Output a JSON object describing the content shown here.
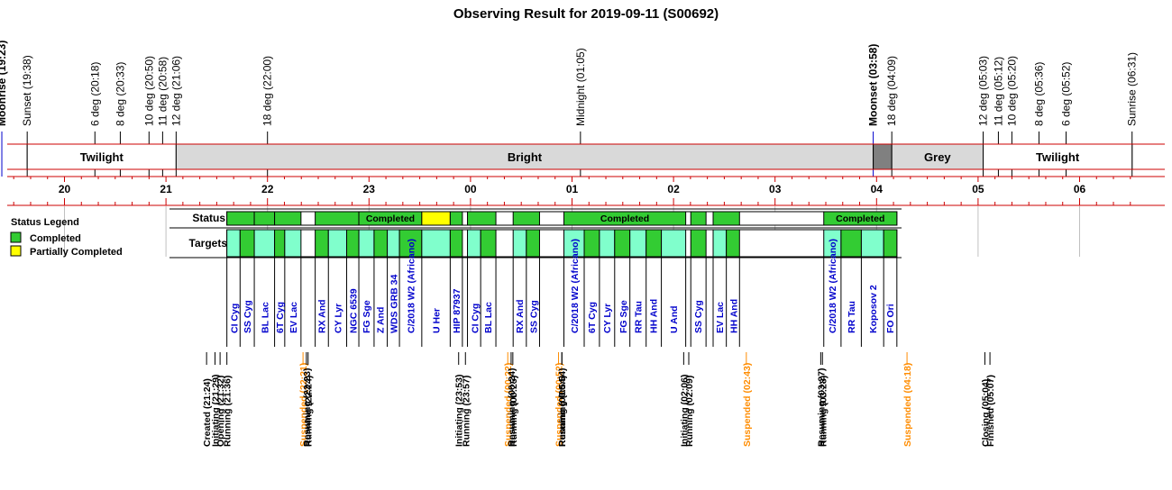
{
  "chart_data": {
    "type": "timeline",
    "title": "Observing Result for 2019-09-11 (S00692)",
    "time_axis": {
      "start_hour": 19.383,
      "end_hour": 30.533,
      "tick_labels": [
        "20",
        "21",
        "22",
        "23",
        "00",
        "01",
        "02",
        "03",
        "04",
        "05",
        "06"
      ]
    },
    "colors": {
      "completed": "#33cc33",
      "partially_completed": "#ffff00",
      "target_alt": "#80ffcc",
      "twilight_band": "#ffffff",
      "bright_band": "#d9d9d9",
      "dark_band": "#808080",
      "grey_band": "#d9d9d9",
      "axis_red": "#cc0000",
      "moon_blue": "#0000cc",
      "suspended_orange": "#ff8c00"
    },
    "sky_events": [
      {
        "label": "Moonrise (19:23)",
        "t": 19.383,
        "moon": true
      },
      {
        "label": "Sunset (19:38)",
        "t": 19.633,
        "moon": false
      },
      {
        "label": "6 deg (20:18)",
        "t": 20.3,
        "moon": false
      },
      {
        "label": "8 deg (20:33)",
        "t": 20.55,
        "moon": false
      },
      {
        "label": "10 deg (20:50)",
        "t": 20.833,
        "moon": false
      },
      {
        "label": "11 deg (20:58)",
        "t": 20.967,
        "moon": false
      },
      {
        "label": "12 deg (21:06)",
        "t": 21.1,
        "moon": false
      },
      {
        "label": "18 deg (22:00)",
        "t": 22.0,
        "moon": false
      },
      {
        "label": "Midnight (01:05)",
        "t": 25.083,
        "moon": false
      },
      {
        "label": "Moonset (03:58)",
        "t": 27.967,
        "moon": true
      },
      {
        "label": "18 deg (04:09)",
        "t": 28.15,
        "moon": false
      },
      {
        "label": "12 deg (05:03)",
        "t": 29.05,
        "moon": false
      },
      {
        "label": "11 deg (05:12)",
        "t": 29.2,
        "moon": false
      },
      {
        "label": "10 deg (05:20)",
        "t": 29.333,
        "moon": false
      },
      {
        "label": "8 deg (05:36)",
        "t": 29.6,
        "moon": false
      },
      {
        "label": "6 deg (05:52)",
        "t": 29.867,
        "moon": false
      },
      {
        "label": "Sunrise (06:31)",
        "t": 30.517,
        "moon": false
      }
    ],
    "sky_bands": [
      {
        "label": "Twilight",
        "t0": 19.633,
        "t1": 21.1,
        "kind": "twilight"
      },
      {
        "label": "Bright",
        "t0": 21.1,
        "t1": 27.967,
        "kind": "bright"
      },
      {
        "label": "",
        "t0": 27.967,
        "t1": 28.15,
        "kind": "dark"
      },
      {
        "label": "Grey",
        "t0": 28.15,
        "t1": 29.05,
        "kind": "grey"
      },
      {
        "label": "Twilight",
        "t0": 29.05,
        "t1": 30.517,
        "kind": "twilight"
      }
    ],
    "row_labels": {
      "status": "Status",
      "targets": "Targets"
    },
    "status_segments": [
      {
        "t0": 21.6,
        "t1": 21.87,
        "state": "completed",
        "label": ""
      },
      {
        "t0": 21.87,
        "t1": 22.07,
        "state": "completed",
        "label": ""
      },
      {
        "t0": 22.07,
        "t1": 22.33,
        "state": "completed",
        "label": ""
      },
      {
        "t0": 22.47,
        "t1": 22.9,
        "state": "completed",
        "label": ""
      },
      {
        "t0": 22.9,
        "t1": 23.52,
        "state": "completed",
        "label": "Completed"
      },
      {
        "t0": 23.52,
        "t1": 23.8,
        "state": "partial",
        "label": ""
      },
      {
        "t0": 23.8,
        "t1": 23.92,
        "state": "completed",
        "label": ""
      },
      {
        "t0": 23.97,
        "t1": 24.25,
        "state": "completed",
        "label": ""
      },
      {
        "t0": 24.42,
        "t1": 24.68,
        "state": "completed",
        "label": ""
      },
      {
        "t0": 24.92,
        "t1": 26.12,
        "state": "completed",
        "label": "Completed"
      },
      {
        "t0": 26.17,
        "t1": 26.32,
        "state": "completed",
        "label": ""
      },
      {
        "t0": 26.39,
        "t1": 26.65,
        "state": "completed",
        "label": ""
      },
      {
        "t0": 27.48,
        "t1": 28.2,
        "state": "completed",
        "label": "Completed"
      }
    ],
    "target_segments": [
      {
        "t0": 21.6,
        "t1": 21.73,
        "state": "alt"
      },
      {
        "t0": 21.73,
        "t1": 21.87,
        "state": "completed"
      },
      {
        "t0": 21.87,
        "t1": 22.07,
        "state": "alt"
      },
      {
        "t0": 22.07,
        "t1": 22.17,
        "state": "completed"
      },
      {
        "t0": 22.17,
        "t1": 22.33,
        "state": "alt"
      },
      {
        "t0": 22.47,
        "t1": 22.6,
        "state": "completed"
      },
      {
        "t0": 22.6,
        "t1": 22.78,
        "state": "alt"
      },
      {
        "t0": 22.78,
        "t1": 22.9,
        "state": "completed"
      },
      {
        "t0": 22.9,
        "t1": 23.05,
        "state": "alt"
      },
      {
        "t0": 23.05,
        "t1": 23.18,
        "state": "completed"
      },
      {
        "t0": 23.18,
        "t1": 23.3,
        "state": "alt"
      },
      {
        "t0": 23.3,
        "t1": 23.52,
        "state": "completed"
      },
      {
        "t0": 23.52,
        "t1": 23.8,
        "state": "alt"
      },
      {
        "t0": 23.8,
        "t1": 23.92,
        "state": "completed"
      },
      {
        "t0": 23.97,
        "t1": 24.1,
        "state": "alt"
      },
      {
        "t0": 24.1,
        "t1": 24.25,
        "state": "completed"
      },
      {
        "t0": 24.42,
        "t1": 24.55,
        "state": "alt"
      },
      {
        "t0": 24.55,
        "t1": 24.68,
        "state": "completed"
      },
      {
        "t0": 24.92,
        "t1": 25.12,
        "state": "alt"
      },
      {
        "t0": 25.12,
        "t1": 25.27,
        "state": "completed"
      },
      {
        "t0": 25.27,
        "t1": 25.42,
        "state": "alt"
      },
      {
        "t0": 25.42,
        "t1": 25.57,
        "state": "completed"
      },
      {
        "t0": 25.57,
        "t1": 25.73,
        "state": "alt"
      },
      {
        "t0": 25.73,
        "t1": 25.88,
        "state": "completed"
      },
      {
        "t0": 25.88,
        "t1": 26.12,
        "state": "alt"
      },
      {
        "t0": 26.17,
        "t1": 26.32,
        "state": "completed"
      },
      {
        "t0": 26.39,
        "t1": 26.52,
        "state": "alt"
      },
      {
        "t0": 26.52,
        "t1": 26.65,
        "state": "completed"
      },
      {
        "t0": 27.48,
        "t1": 27.65,
        "state": "alt"
      },
      {
        "t0": 27.65,
        "t1": 27.85,
        "state": "completed"
      },
      {
        "t0": 27.85,
        "t1": 28.07,
        "state": "alt"
      },
      {
        "t0": 28.07,
        "t1": 28.2,
        "state": "completed"
      }
    ],
    "target_labels": [
      {
        "name": "CI Cyg",
        "t": 21.67
      },
      {
        "name": "SS Cyg",
        "t": 21.8
      },
      {
        "name": "BL Lac",
        "t": 21.97
      },
      {
        "name": "6T Cyg",
        "t": 22.12
      },
      {
        "name": "EV Lac",
        "t": 22.25
      },
      {
        "name": "RX And",
        "t": 22.53
      },
      {
        "name": "CY Lyr",
        "t": 22.69
      },
      {
        "name": "NGC 6539",
        "t": 22.84
      },
      {
        "name": "FG Sge",
        "t": 22.97
      },
      {
        "name": "Z And",
        "t": 23.11
      },
      {
        "name": "WDS GRB 34",
        "t": 23.24
      },
      {
        "name": "C/2018 W2 (Africano)",
        "t": 23.41
      },
      {
        "name": "U Her",
        "t": 23.66
      },
      {
        "name": "HIP 87937",
        "t": 23.86
      },
      {
        "name": "CI Cyg",
        "t": 24.04
      },
      {
        "name": "BL Lac",
        "t": 24.17
      },
      {
        "name": "RX And",
        "t": 24.48
      },
      {
        "name": "SS Cyg",
        "t": 24.62
      },
      {
        "name": "C/2018 W2 (Africano)",
        "t": 25.02
      },
      {
        "name": "6T Cyg",
        "t": 25.19
      },
      {
        "name": "CY Lyr",
        "t": 25.34
      },
      {
        "name": "FG Sge",
        "t": 25.5
      },
      {
        "name": "RR Tau",
        "t": 25.65
      },
      {
        "name": "HH And",
        "t": 25.8
      },
      {
        "name": "U And",
        "t": 26.0
      },
      {
        "name": "SS Cyg",
        "t": 26.24
      },
      {
        "name": "EV Lac",
        "t": 26.45
      },
      {
        "name": "HH And",
        "t": 26.59
      },
      {
        "name": "C/2018 W2 (Africano)",
        "t": 27.56
      },
      {
        "name": "RR Tau",
        "t": 27.75
      },
      {
        "name": "Koposov 2",
        "t": 27.96
      },
      {
        "name": "FO Ori",
        "t": 28.13
      }
    ],
    "log_events": [
      {
        "label": "Created (21:24)",
        "t": 21.4,
        "suspended": false
      },
      {
        "label": "Initiating (21:29)",
        "t": 21.483,
        "suspended": false
      },
      {
        "label": "Opening (21:32)",
        "t": 21.533,
        "suspended": false
      },
      {
        "label": "Running (21:36)",
        "t": 21.6,
        "suspended": false
      },
      {
        "label": "Suspended (22:21)",
        "t": 22.35,
        "suspended": true
      },
      {
        "label": "Resuming (22:23)",
        "t": 22.383,
        "suspended": false
      },
      {
        "label": "Running (22:24)",
        "t": 22.4,
        "suspended": false
      },
      {
        "label": "Initiating (23:53)",
        "t": 23.883,
        "suspended": false
      },
      {
        "label": "Running (23:57)",
        "t": 23.95,
        "suspended": false
      },
      {
        "label": "Suspended (00:22)",
        "t": 24.367,
        "suspended": true
      },
      {
        "label": "Resuming (00:24)",
        "t": 24.4,
        "suspended": false
      },
      {
        "label": "Running (00:25)",
        "t": 24.417,
        "suspended": false
      },
      {
        "label": "Suspended (00:52)",
        "t": 24.867,
        "suspended": true
      },
      {
        "label": "Resuming (00:54)",
        "t": 24.9,
        "suspended": false
      },
      {
        "label": "Running (00:54)",
        "t": 24.9,
        "suspended": false
      },
      {
        "label": "Initiating (02:06)",
        "t": 26.1,
        "suspended": false
      },
      {
        "label": "Running (02:09)",
        "t": 26.15,
        "suspended": false
      },
      {
        "label": "Suspended (02:43)",
        "t": 26.717,
        "suspended": true
      },
      {
        "label": "Resuming (03:27)",
        "t": 27.45,
        "suspended": false
      },
      {
        "label": "Running (03:28)",
        "t": 27.467,
        "suspended": false
      },
      {
        "label": "Suspended (04:18)",
        "t": 28.3,
        "suspended": true
      },
      {
        "label": "Closing (05:04)",
        "t": 29.067,
        "suspended": false
      },
      {
        "label": "Finished (05:07)",
        "t": 29.117,
        "suspended": false
      }
    ],
    "legend": {
      "title": "Status Legend",
      "placement": "left",
      "items": [
        {
          "label": "Completed",
          "color": "#33cc33"
        },
        {
          "label": "Partially Completed",
          "color": "#ffff00"
        }
      ]
    }
  }
}
